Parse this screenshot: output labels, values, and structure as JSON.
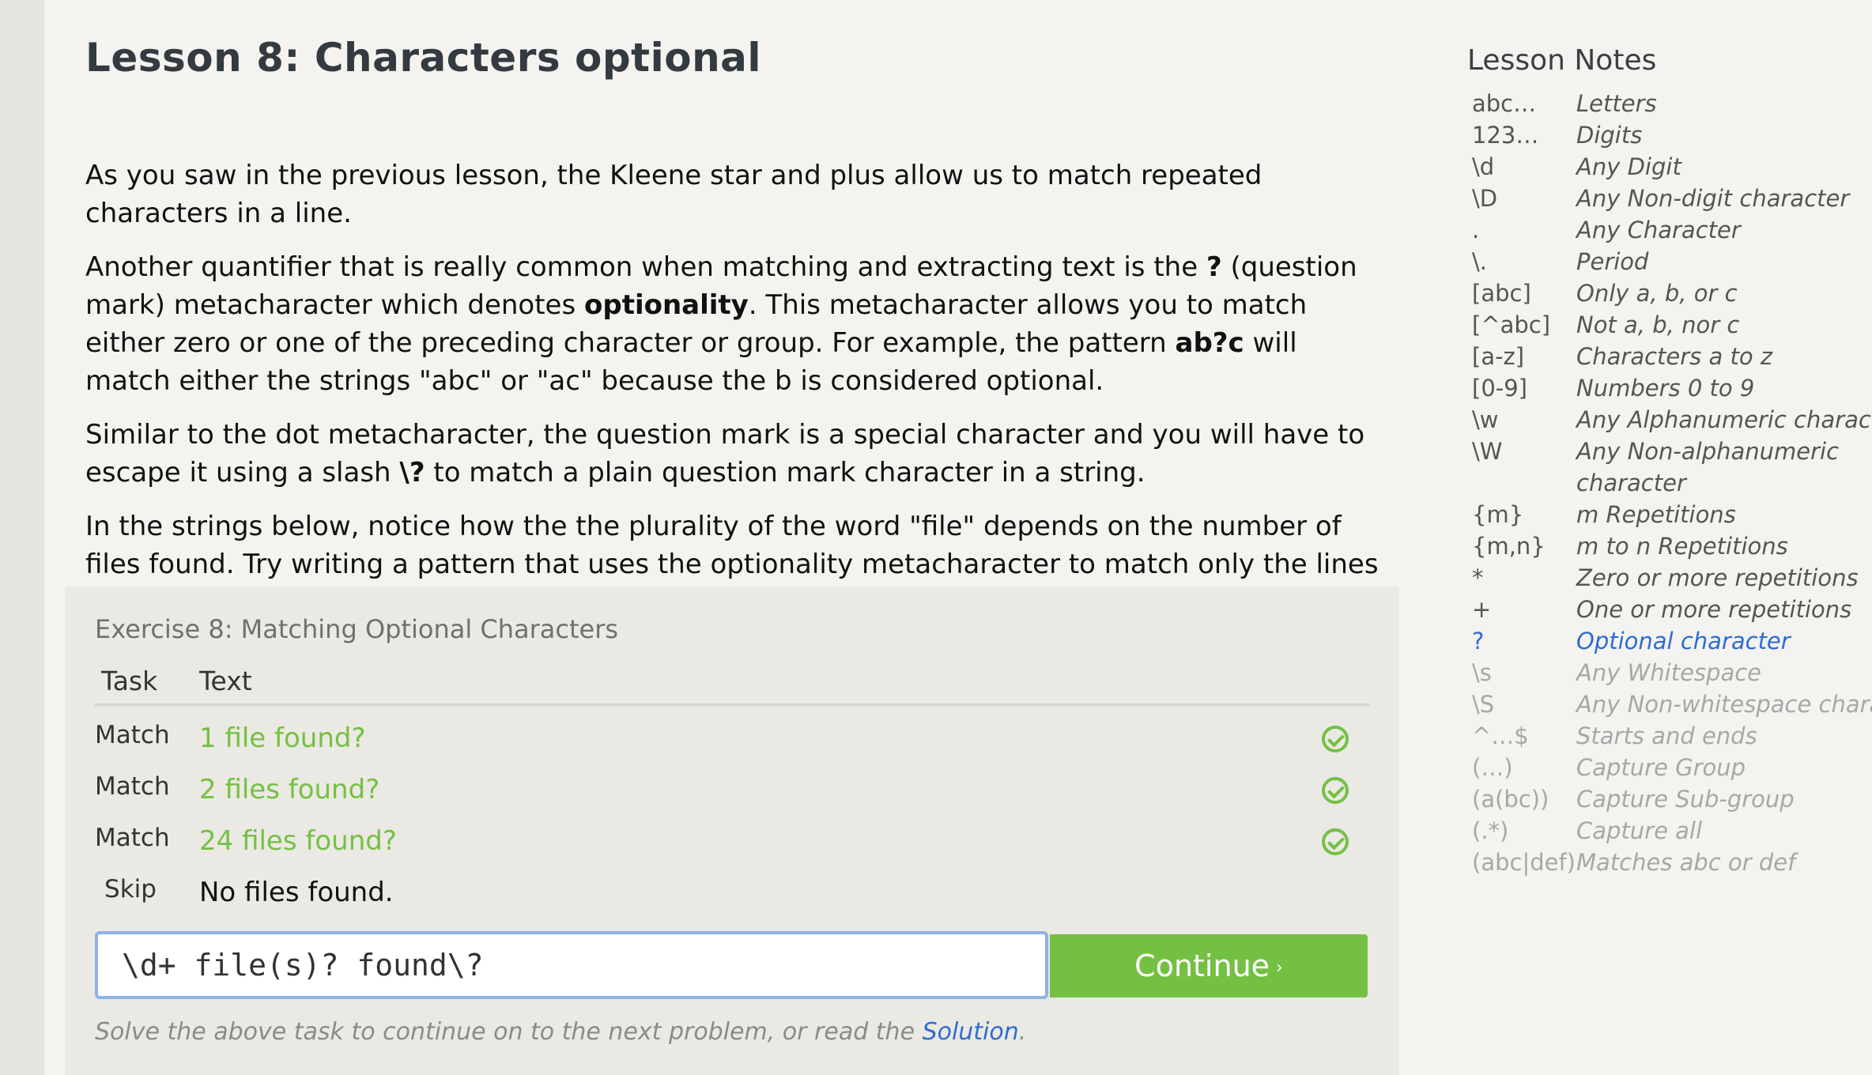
{
  "lesson": {
    "title": "Lesson 8: Characters optional",
    "p1": "As you saw in the previous lesson, the Kleene star and plus allow us to match repeated characters in a line.",
    "p2": {
      "a": "Another quantifier that is really common when matching and extracting text is the ",
      "b": "?",
      "c": " (question mark) metacharacter which denotes ",
      "d": "optionality",
      "e": ". This metacharacter allows you to match either zero or one of the preceding character or group. For example, the pattern ",
      "f": "ab?c",
      "g": " will match either the strings \"abc\" or \"ac\" because the b is considered optional."
    },
    "p3": {
      "a": "Similar to the dot metacharacter, the question mark is a special character and you will have to escape it using a slash ",
      "b": "\\?",
      "c": " to match a plain question mark character in a string."
    },
    "p4": "In the strings below, notice how the the plurality of the word \"file\" depends on the number of files found. Try writing a pattern that uses the optionality metacharacter to match only the lines where one or more files were found."
  },
  "exercise": {
    "title": "Exercise 8: Matching Optional Characters",
    "col_task": "Task",
    "col_text": "Text",
    "rows": [
      {
        "task": "Match",
        "text": "1 file found?"
      },
      {
        "task": "Match",
        "text": "2 files found?"
      },
      {
        "task": "Match",
        "text": "24 files found?"
      },
      {
        "task": "Skip",
        "text": "No files found."
      }
    ],
    "input_value": "\\d+ file(s)? found\\?",
    "continue_label": "Continue",
    "continue_chevron": "›",
    "hint_prefix": "Solve the above task to continue on to the next problem, or read the ",
    "hint_link": "Solution",
    "hint_suffix": "."
  },
  "notes": {
    "title": "Lesson Notes",
    "items": [
      {
        "k": "abc…",
        "v": "Letters"
      },
      {
        "k": "123…",
        "v": "Digits"
      },
      {
        "k": "\\d",
        "v": "Any Digit"
      },
      {
        "k": "\\D",
        "v": "Any Non-digit character"
      },
      {
        "k": ".",
        "v": "Any Character"
      },
      {
        "k": "\\.",
        "v": "Period"
      },
      {
        "k": "[abc]",
        "v": "Only a, b, or c"
      },
      {
        "k": "[^abc]",
        "v": "Not a, b, nor c"
      },
      {
        "k": "[a-z]",
        "v": "Characters a to z"
      },
      {
        "k": "[0-9]",
        "v": "Numbers 0 to 9"
      },
      {
        "k": "\\w",
        "v": "Any Alphanumeric character"
      },
      {
        "k": "\\W",
        "v": "Any Non-alphanumeric"
      },
      {
        "k": "",
        "v": "character"
      },
      {
        "k": "{m}",
        "v": "m Repetitions"
      },
      {
        "k": "{m,n}",
        "v": "m to n Repetitions"
      },
      {
        "k": "*",
        "v": "Zero or more repetitions"
      },
      {
        "k": "+",
        "v": "One or more repetitions"
      },
      {
        "k": "?",
        "v": "Optional character"
      },
      {
        "k": "\\s",
        "v": "Any Whitespace"
      },
      {
        "k": "\\S",
        "v": "Any Non-whitespace characte"
      },
      {
        "k": "^…$",
        "v": "Starts and ends"
      },
      {
        "k": "(…)",
        "v": "Capture Group"
      },
      {
        "k": "(a(bc))",
        "v": "Capture Sub-group"
      },
      {
        "k": "(.*)",
        "v": "Capture all"
      },
      {
        "k": "(abc|def)",
        "v": "Matches abc or def"
      }
    ]
  },
  "colors": {
    "success": "#74c043",
    "link": "#2e6cd1",
    "input_border": "#8fb1e6"
  }
}
